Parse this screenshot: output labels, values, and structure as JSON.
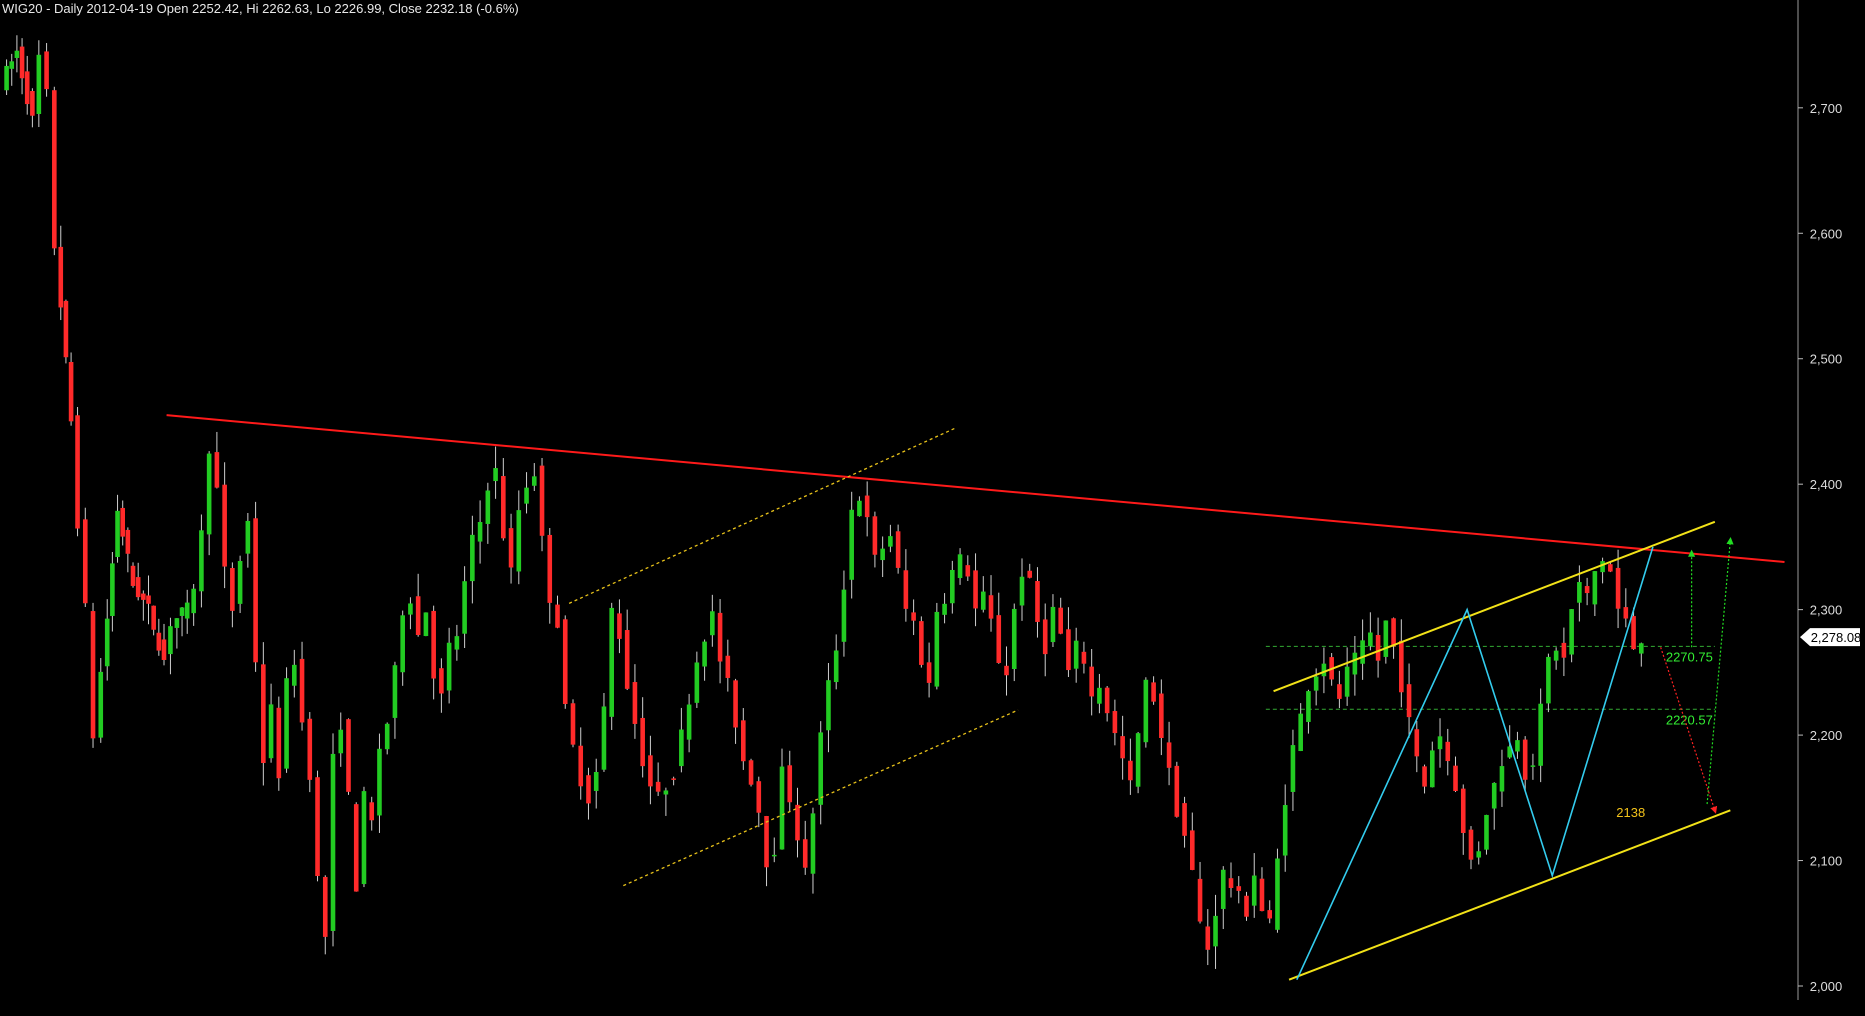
{
  "header": {
    "title": "WIG20 - Daily 2012-04-19 Open 2252.42, Hi 2262.63, Lo 2226.99, Close 2232.18 (-0.6%)"
  },
  "colors": {
    "background": "#000000",
    "up_candle": "#22cc22",
    "down_candle": "#ff2a2a",
    "wick": "#cfcfcf",
    "resistance_line": "#ff1a1a",
    "channel_line": "#f2e218",
    "dotted_channel": "#e8c21a",
    "zigzag": "#33ccee",
    "level_line": "#33aa33",
    "level_label": "#33ee33",
    "target_label": "#f2c21a",
    "axis_text": "#dcdcdc",
    "up_arrow": "#22dd22",
    "down_arrow": "#ff2222"
  },
  "chart_data": {
    "type": "candlestick",
    "title": "WIG20 - Daily 2012-04-19 Open 2252.42, Hi 2262.63, Lo 2226.99, Close 2232.18 (-0.6%)",
    "ylim": [
      2000,
      2770
    ],
    "y_ticks": [
      {
        "value": 2000,
        "label": "2,000"
      },
      {
        "value": 2100,
        "label": "2,100"
      },
      {
        "value": 2200,
        "label": "2,200"
      },
      {
        "value": 2300,
        "label": "2,300"
      },
      {
        "value": 2400,
        "label": "2,400"
      },
      {
        "value": 2500,
        "label": "2,500"
      },
      {
        "value": 2600,
        "label": "2,600"
      },
      {
        "value": 2700,
        "label": "2,700"
      }
    ],
    "last_value": {
      "value": 2278.08,
      "label": "2,278.08"
    },
    "path_points": [
      [
        0,
        2720
      ],
      [
        2,
        2745
      ],
      [
        4,
        2690
      ],
      [
        5,
        2740
      ],
      [
        6,
        2710
      ],
      [
        7,
        2590
      ],
      [
        9,
        2450
      ],
      [
        10,
        2370
      ],
      [
        11,
        2300
      ],
      [
        12,
        2200
      ],
      [
        13,
        2250
      ],
      [
        15,
        2380
      ],
      [
        17,
        2320
      ],
      [
        19,
        2300
      ],
      [
        21,
        2260
      ],
      [
        22,
        2290
      ],
      [
        24,
        2300
      ],
      [
        25,
        2320
      ],
      [
        26,
        2360
      ],
      [
        27,
        2430
      ],
      [
        28,
        2395
      ],
      [
        29,
        2330
      ],
      [
        30,
        2300
      ],
      [
        31,
        2340
      ],
      [
        32,
        2370
      ],
      [
        33,
        2260
      ],
      [
        34,
        2180
      ],
      [
        35,
        2220
      ],
      [
        36,
        2170
      ],
      [
        37,
        2240
      ],
      [
        38,
        2260
      ],
      [
        39,
        2210
      ],
      [
        40,
        2170
      ],
      [
        41,
        2085
      ],
      [
        42,
        2040
      ],
      [
        43,
        2180
      ],
      [
        44,
        2210
      ],
      [
        45,
        2150
      ],
      [
        46,
        2080
      ],
      [
        47,
        2150
      ],
      [
        48,
        2130
      ],
      [
        49,
        2190
      ],
      [
        50,
        2210
      ],
      [
        51,
        2250
      ],
      [
        52,
        2300
      ],
      [
        53,
        2310
      ],
      [
        54,
        2280
      ],
      [
        55,
        2300
      ],
      [
        56,
        2250
      ],
      [
        57,
        2230
      ],
      [
        58,
        2270
      ],
      [
        59,
        2280
      ],
      [
        60,
        2320
      ],
      [
        61,
        2355
      ],
      [
        62,
        2370
      ],
      [
        63,
        2400
      ],
      [
        64,
        2410
      ],
      [
        65,
        2360
      ],
      [
        66,
        2330
      ],
      [
        67,
        2380
      ],
      [
        68,
        2400
      ],
      [
        69,
        2410
      ],
      [
        70,
        2355
      ],
      [
        71,
        2310
      ],
      [
        72,
        2290
      ],
      [
        73,
        2220
      ],
      [
        74,
        2190
      ],
      [
        75,
        2165
      ],
      [
        76,
        2150
      ],
      [
        77,
        2170
      ],
      [
        78,
        2220
      ],
      [
        79,
        2300
      ],
      [
        80,
        2280
      ],
      [
        81,
        2240
      ],
      [
        82,
        2210
      ],
      [
        83,
        2180
      ],
      [
        84,
        2160
      ],
      [
        85,
        2150
      ],
      [
        86,
        2160
      ],
      [
        87,
        2170
      ],
      [
        88,
        2200
      ],
      [
        89,
        2230
      ],
      [
        90,
        2260
      ],
      [
        91,
        2280
      ],
      [
        92,
        2295
      ],
      [
        93,
        2260
      ],
      [
        94,
        2240
      ],
      [
        95,
        2210
      ],
      [
        96,
        2180
      ],
      [
        97,
        2165
      ],
      [
        98,
        2140
      ],
      [
        99,
        2100
      ],
      [
        100,
        2110
      ],
      [
        101,
        2170
      ],
      [
        102,
        2150
      ],
      [
        103,
        2120
      ],
      [
        104,
        2090
      ],
      [
        105,
        2140
      ],
      [
        106,
        2200
      ],
      [
        107,
        2240
      ],
      [
        108,
        2270
      ],
      [
        109,
        2320
      ],
      [
        110,
        2380
      ],
      [
        111,
        2390
      ],
      [
        112,
        2370
      ],
      [
        113,
        2340
      ],
      [
        114,
        2350
      ],
      [
        115,
        2360
      ],
      [
        116,
        2330
      ],
      [
        117,
        2300
      ],
      [
        118,
        2290
      ],
      [
        119,
        2260
      ],
      [
        120,
        2240
      ],
      [
        121,
        2300
      ],
      [
        122,
        2310
      ],
      [
        123,
        2330
      ],
      [
        124,
        2340
      ],
      [
        125,
        2330
      ],
      [
        126,
        2300
      ],
      [
        127,
        2310
      ],
      [
        128,
        2290
      ],
      [
        129,
        2260
      ],
      [
        130,
        2250
      ],
      [
        131,
        2300
      ],
      [
        132,
        2330
      ],
      [
        133,
        2320
      ],
      [
        134,
        2290
      ],
      [
        135,
        2270
      ],
      [
        136,
        2300
      ],
      [
        137,
        2280
      ],
      [
        138,
        2250
      ],
      [
        139,
        2270
      ],
      [
        140,
        2260
      ],
      [
        141,
        2230
      ],
      [
        142,
        2240
      ],
      [
        143,
        2220
      ],
      [
        144,
        2200
      ],
      [
        145,
        2180
      ],
      [
        146,
        2160
      ],
      [
        147,
        2200
      ],
      [
        148,
        2240
      ],
      [
        149,
        2230
      ],
      [
        150,
        2200
      ],
      [
        151,
        2170
      ],
      [
        152,
        2140
      ],
      [
        153,
        2120
      ],
      [
        154,
        2090
      ],
      [
        155,
        2050
      ],
      [
        156,
        2030
      ],
      [
        157,
        2060
      ],
      [
        158,
        2090
      ],
      [
        159,
        2080
      ],
      [
        160,
        2070
      ],
      [
        161,
        2060
      ],
      [
        162,
        2090
      ],
      [
        163,
        2060
      ],
      [
        164,
        2050
      ],
      [
        165,
        2100
      ],
      [
        166,
        2150
      ],
      [
        167,
        2190
      ],
      [
        168,
        2215
      ],
      [
        169,
        2240
      ],
      [
        170,
        2250
      ],
      [
        171,
        2260
      ],
      [
        172,
        2240
      ],
      [
        173,
        2230
      ],
      [
        174,
        2250
      ],
      [
        175,
        2260
      ],
      [
        176,
        2270
      ],
      [
        177,
        2280
      ],
      [
        178,
        2260
      ],
      [
        179,
        2290
      ],
      [
        180,
        2270
      ],
      [
        181,
        2240
      ],
      [
        182,
        2210
      ],
      [
        183,
        2180
      ],
      [
        184,
        2160
      ],
      [
        185,
        2190
      ],
      [
        186,
        2200
      ],
      [
        187,
        2180
      ],
      [
        188,
        2160
      ],
      [
        189,
        2120
      ],
      [
        190,
        2100
      ],
      [
        191,
        2110
      ],
      [
        192,
        2140
      ],
      [
        193,
        2160
      ],
      [
        194,
        2180
      ],
      [
        195,
        2190
      ],
      [
        196,
        2200
      ],
      [
        197,
        2170
      ],
      [
        198,
        2180
      ],
      [
        199,
        2220
      ],
      [
        200,
        2260
      ],
      [
        201,
        2270
      ],
      [
        202,
        2260
      ],
      [
        203,
        2300
      ],
      [
        204,
        2320
      ],
      [
        205,
        2310
      ],
      [
        206,
        2330
      ],
      [
        207,
        2340
      ],
      [
        208,
        2330
      ],
      [
        209,
        2300
      ],
      [
        210,
        2290
      ],
      [
        211,
        2270
      ],
      [
        212,
        2278
      ]
    ],
    "trendlines": {
      "resistance": [
        [
          21,
          2455
        ],
        [
          230,
          2338
        ]
      ],
      "upper_channel_solid": [
        [
          164,
          2235
        ],
        [
          221,
          2370
        ]
      ],
      "lower_channel_solid": [
        [
          166,
          2005
        ],
        [
          223,
          2140
        ]
      ],
      "upper_channel_dotted": [
        [
          73,
          2305
        ],
        [
          123,
          2445
        ]
      ],
      "lower_channel_dotted": [
        [
          80,
          2080
        ],
        [
          131,
          2220
        ]
      ]
    },
    "zigzag": [
      [
        167,
        2005
      ],
      [
        189,
        2300
      ],
      [
        200,
        2088
      ],
      [
        213,
        2350
      ]
    ],
    "levels": [
      {
        "value": 2270.75,
        "label": "2270.75"
      },
      {
        "value": 2220.57,
        "label": "2220.57"
      }
    ],
    "target": {
      "value": 2138,
      "label": "2138"
    },
    "projection_arrows": {
      "up_short": [
        [
          218,
          2270
        ],
        [
          218,
          2345
        ]
      ],
      "up_long": [
        [
          220,
          2145
        ],
        [
          223,
          2355
        ]
      ],
      "down": [
        [
          214,
          2270
        ],
        [
          221,
          2140
        ]
      ]
    },
    "x_range": [
      0,
      232
    ]
  }
}
